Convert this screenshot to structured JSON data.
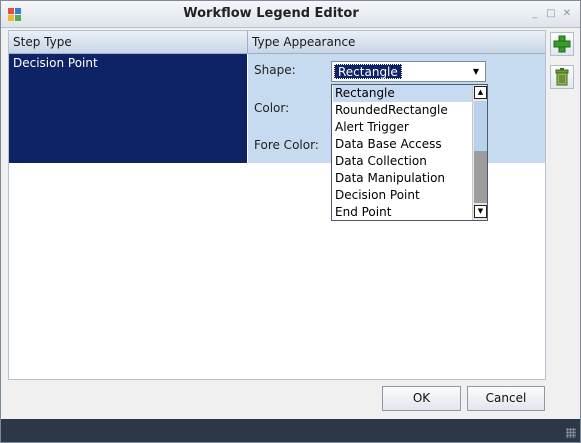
{
  "window": {
    "title": "Workflow Legend Editor",
    "controls": {
      "minimize": "_",
      "maximize": "□",
      "close": "✕"
    }
  },
  "grid": {
    "columns": [
      "Step Type",
      "Type Appearance"
    ],
    "row": {
      "step_type": "Decision Point",
      "shape_label": "Shape:",
      "color_label": "Color:",
      "fore_color_label": "Fore Color:",
      "shape_value": "Rectangle"
    }
  },
  "dropdown": {
    "options": [
      "Rectangle",
      "RoundedRectangle",
      "Alert Trigger",
      "Data Base Access",
      "Data Collection",
      "Data Manipulation",
      "Decision Point",
      "End Point"
    ],
    "selected_index": 0
  },
  "side_buttons": [
    {
      "name": "add-button",
      "icon": "plus-icon",
      "color": "#3a9a2a"
    },
    {
      "name": "delete-button",
      "icon": "trash-icon",
      "color": "#5a8a2a"
    }
  ],
  "buttons": {
    "ok": "OK",
    "cancel": "Cancel"
  },
  "colors": {
    "selected_row": "#0d2366",
    "property_bg": "#c7dbf0",
    "status_bar": "#2c3848"
  }
}
